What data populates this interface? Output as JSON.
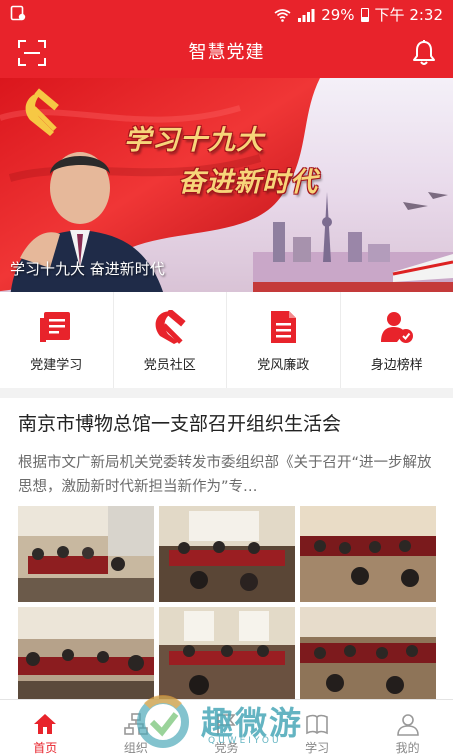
{
  "status_bar": {
    "battery": "29%",
    "time": "下午 2:32",
    "battery_level": 0.29
  },
  "header": {
    "title": "智慧党建",
    "scan_icon": "scan-icon",
    "bell_icon": "bell-icon"
  },
  "banner": {
    "headline_line1": "学习十九大",
    "headline_line2": "奋进新时代",
    "caption": "学习十九大 奋进新时代"
  },
  "quick_nav": [
    {
      "label": "党建学习",
      "icon": "book-icon"
    },
    {
      "label": "党员社区",
      "icon": "party-emblem-icon"
    },
    {
      "label": "党风廉政",
      "icon": "document-icon"
    },
    {
      "label": "身边榜样",
      "icon": "person-badge-icon"
    }
  ],
  "news": {
    "title": "南京市博物总馆一支部召开组织生活会",
    "summary": "根据市文广新局机关党委转发市委组织部《关于召开“进一步解放思想，激励新时代新担当新作为”专…"
  },
  "bottom_nav": [
    {
      "label": "首页",
      "icon": "home-icon",
      "active": true
    },
    {
      "label": "组织",
      "icon": "org-icon",
      "active": false
    },
    {
      "label": "党务",
      "icon": "flag-icon",
      "active": false
    },
    {
      "label": "学习",
      "icon": "study-icon",
      "active": false
    },
    {
      "label": "我的",
      "icon": "user-icon",
      "active": false
    }
  ],
  "watermark": {
    "text": "趣微游",
    "sub": "QUWEIYOU"
  },
  "colors": {
    "brand_red": "#e8232b",
    "text_gray": "#6b6b6b"
  }
}
